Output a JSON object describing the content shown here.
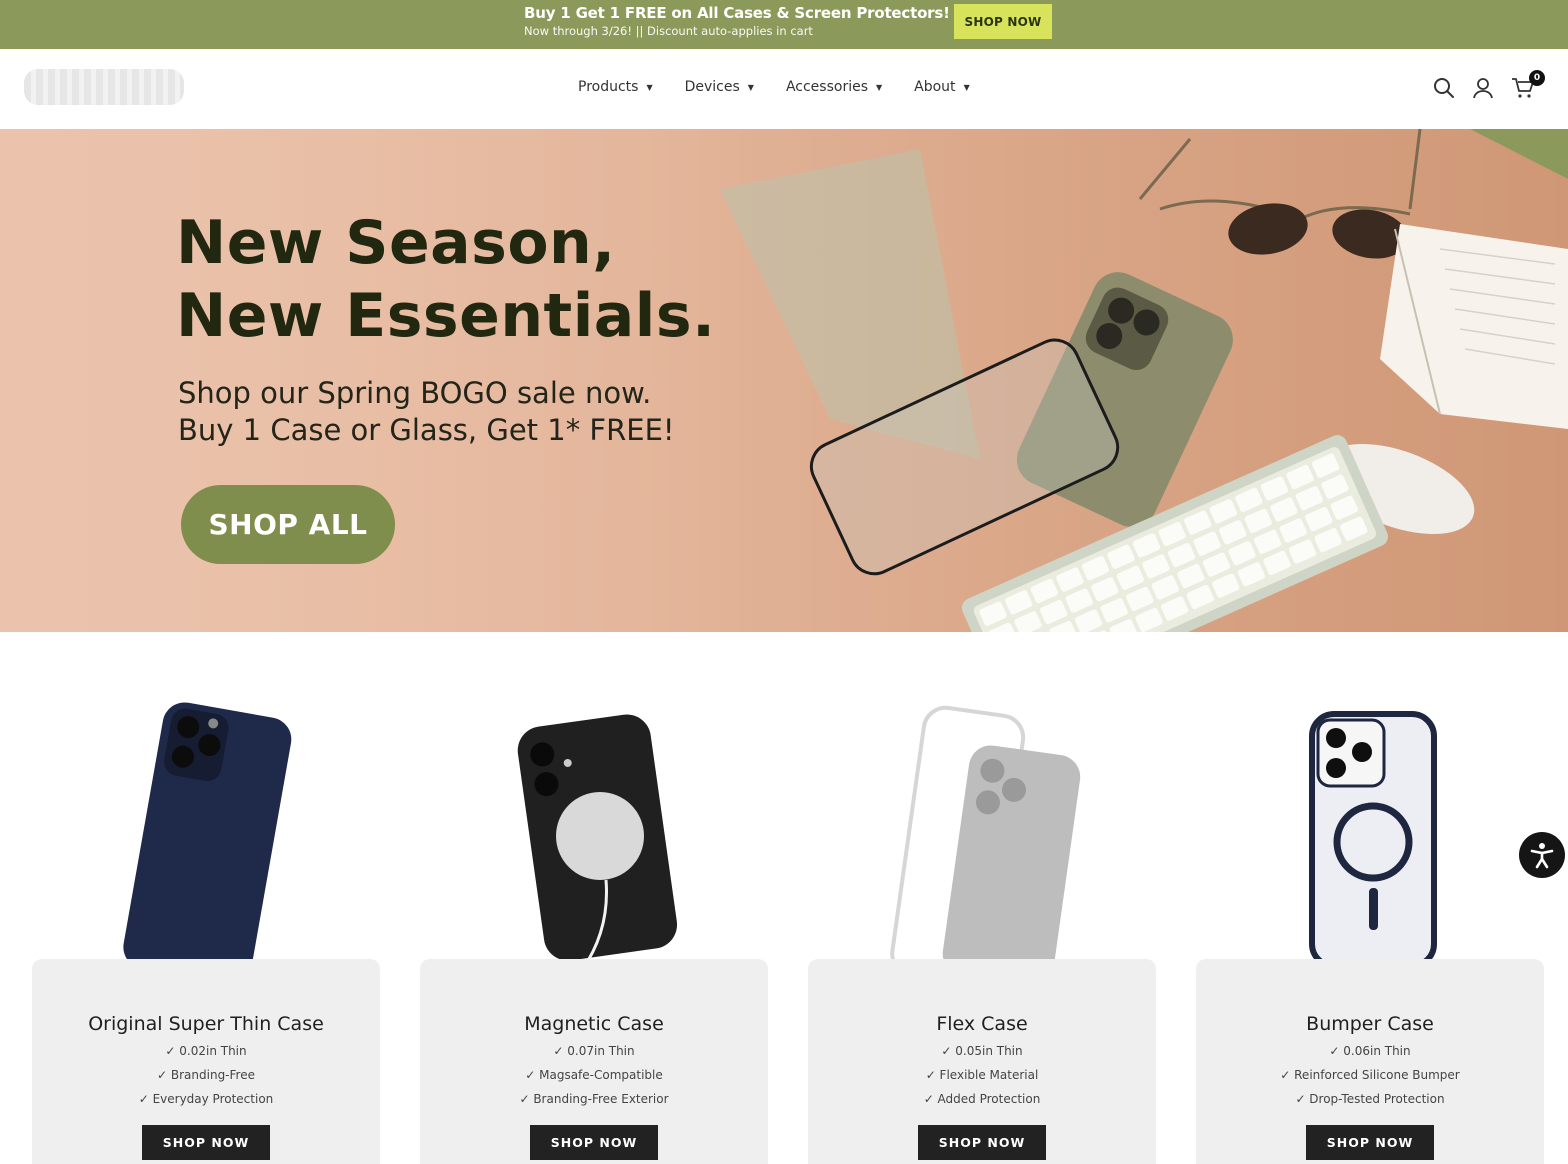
{
  "promo": {
    "title": "Buy 1 Get 1 FREE on All Cases & Screen Protectors!",
    "subtitle": "Now through 3/26! || Discount auto-applies in cart",
    "button_label": "SHOP NOW",
    "bg_color": "#8b9a5a",
    "button_color": "#d7e35a"
  },
  "header": {
    "nav": [
      {
        "label": "Products",
        "icon": "caret-down-icon"
      },
      {
        "label": "Devices",
        "icon": "caret-down-icon"
      },
      {
        "label": "Accessories",
        "icon": "caret-down-icon"
      },
      {
        "label": "About",
        "icon": "caret-down-icon"
      }
    ],
    "icons": [
      "search-icon",
      "account-icon",
      "cart-icon"
    ],
    "cart_count": "0"
  },
  "hero": {
    "title_line1": "New Season,",
    "title_line2": "New Essentials.",
    "sub_line1": "Shop our Spring BOGO sale now.",
    "sub_line2": "Buy 1 Case or Glass, Get 1* FREE!",
    "button_label": "SHOP ALL",
    "accent_color": "#7f8d4d"
  },
  "products": [
    {
      "title": "Original Super Thin Case",
      "features": [
        "✓ 0.02in Thin",
        "✓ Branding-Free",
        "✓ Everyday Protection"
      ],
      "button_label": "SHOP NOW"
    },
    {
      "title": "Magnetic Case",
      "features": [
        "✓ 0.07in Thin",
        "✓ Magsafe-Compatible",
        "✓ Branding-Free Exterior"
      ],
      "button_label": "SHOP NOW"
    },
    {
      "title": "Flex Case",
      "features": [
        "✓ 0.05in Thin",
        "✓ Flexible Material",
        "✓ Added Protection"
      ],
      "button_label": "SHOP NOW"
    },
    {
      "title": "Bumper Case",
      "features": [
        "✓ 0.06in Thin",
        "✓ Reinforced Silicone Bumper",
        "✓ Drop-Tested Protection"
      ],
      "button_label": "SHOP NOW"
    }
  ],
  "accessibility": {
    "icon": "accessibility-icon"
  }
}
